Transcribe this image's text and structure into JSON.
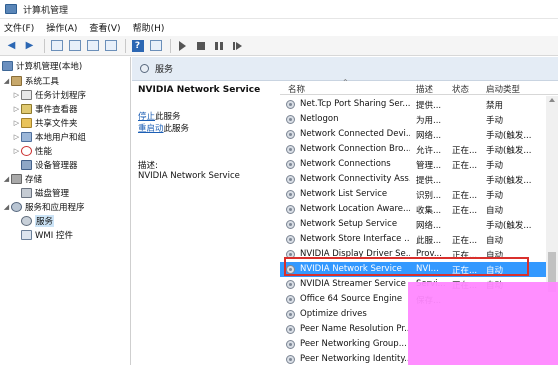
{
  "window": {
    "title": "计算机管理"
  },
  "menu": [
    "文件(F)",
    "操作(A)",
    "查看(V)",
    "帮助(H)"
  ],
  "toolbar": {
    "icons": [
      "back-icon",
      "forward-icon",
      "up-icon",
      "properties-icon",
      "refresh-icon",
      "export-icon",
      "help-icon",
      "play-icon",
      "stop-icon",
      "pause-icon",
      "restart-icon"
    ],
    "help_glyph": "?"
  },
  "tree": {
    "root": "计算机管理(本地)",
    "system_tools": "系统工具",
    "task_scheduler": "任务计划程序",
    "event_viewer": "事件查看器",
    "shared_folders": "共享文件夹",
    "local_users": "本地用户和组",
    "performance": "性能",
    "device_manager": "设备管理器",
    "storage": "存储",
    "disk_management": "磁盘管理",
    "services_apps": "服务和应用程序",
    "services": "服务",
    "wmi": "WMI 控件"
  },
  "header": {
    "title": "服务"
  },
  "details": {
    "service_name": "NVIDIA Network Service",
    "stop_link": "停止",
    "stop_suffix": "此服务",
    "restart_link": "重启动",
    "restart_suffix": "此服务",
    "desc_label": "描述:",
    "desc_text": "NVIDIA Network Service"
  },
  "columns": {
    "name": "名称",
    "desc": "描述",
    "status": "状态",
    "startup": "启动类型"
  },
  "rows": [
    {
      "name": "Net.Tcp Port Sharing Ser...",
      "desc": "提供...",
      "status": "",
      "startup": "禁用"
    },
    {
      "name": "Netlogon",
      "desc": "为用...",
      "status": "",
      "startup": "手动"
    },
    {
      "name": "Network Connected Devi...",
      "desc": "网络...",
      "status": "",
      "startup": "手动(触发..."
    },
    {
      "name": "Network Connection Bro...",
      "desc": "允许...",
      "status": "正在...",
      "startup": "手动(触发..."
    },
    {
      "name": "Network Connections",
      "desc": "管理...",
      "status": "正在...",
      "startup": "手动"
    },
    {
      "name": "Network Connectivity Ass...",
      "desc": "提供...",
      "status": "",
      "startup": "手动(触发..."
    },
    {
      "name": "Network List Service",
      "desc": "识别...",
      "status": "正在...",
      "startup": "手动"
    },
    {
      "name": "Network Location Aware...",
      "desc": "收集...",
      "status": "正在...",
      "startup": "自动"
    },
    {
      "name": "Network Setup Service",
      "desc": "网络...",
      "status": "",
      "startup": "手动(触发..."
    },
    {
      "name": "Network Store Interface ...",
      "desc": "此服...",
      "status": "正在...",
      "startup": "自动"
    },
    {
      "name": "NVIDIA Display Driver Se...",
      "desc": "Prov...",
      "status": "正在...",
      "startup": "自动"
    },
    {
      "name": "NVIDIA Network Service",
      "desc": "NVI...",
      "status": "正在...",
      "startup": "自动"
    },
    {
      "name": "NVIDIA Streamer Service",
      "desc": "Servi...",
      "status": "正在...",
      "startup": "自动"
    },
    {
      "name": "Office 64 Source Engine",
      "desc": "保存...",
      "status": "",
      "startup": ""
    },
    {
      "name": "Optimize drives",
      "desc": "",
      "status": "",
      "startup": ""
    },
    {
      "name": "Peer Name Resolution Pr...",
      "desc": "",
      "status": "",
      "startup": ""
    },
    {
      "name": "Peer Networking Group...",
      "desc": "",
      "status": "",
      "startup": ""
    },
    {
      "name": "Peer Networking Identity...",
      "desc": "",
      "status": "",
      "startup": ""
    }
  ],
  "colors": {
    "selection": "#3399ff",
    "highlight_border": "#d9302c",
    "link": "#1c5fb5"
  }
}
